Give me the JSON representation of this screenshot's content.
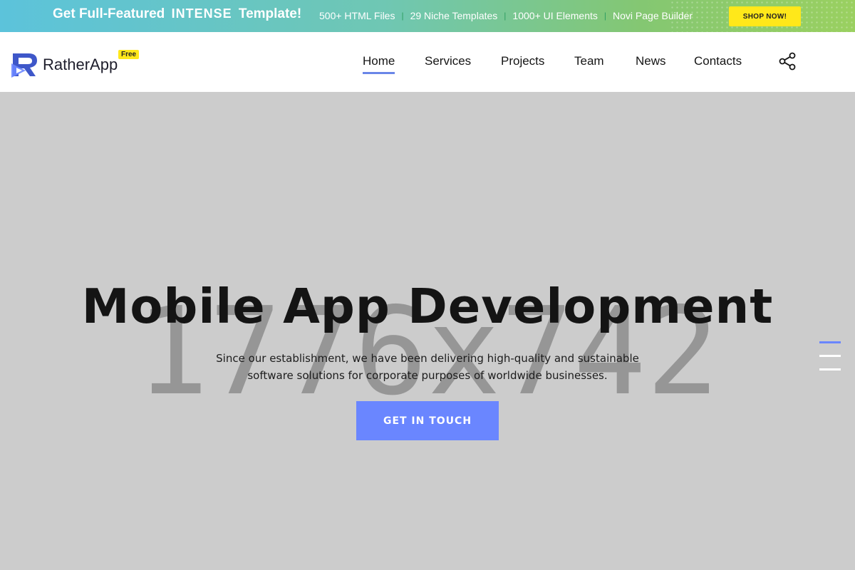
{
  "promo": {
    "headline_prefix": "Get Full-Featured",
    "headline_brand": "INTENSE",
    "headline_suffix": "Template!",
    "features": [
      "500+ HTML Files",
      "29 Niche Templates",
      "1000+ UI Elements",
      "Novi Page Builder"
    ],
    "separator": "|",
    "cta_label": "SHOP NOW!"
  },
  "header": {
    "logo_text": "RatherApp",
    "logo_badge": "Free",
    "nav": [
      "Home",
      "Services",
      "Projects",
      "Team",
      "News",
      "Contacts"
    ],
    "active_nav": "Home"
  },
  "hero": {
    "placeholder_size": "1776x742",
    "title": "Mobile App Development",
    "description_line1": "Since our establishment, we have been delivering high-quality and sustainable",
    "description_line2": "software solutions for corporate purposes of worldwide businesses.",
    "cta_label": "GET IN TOUCH"
  },
  "colors": {
    "accent": "#6a86ff",
    "badge_yellow": "#ffe81a",
    "hero_bg": "#cccccc"
  },
  "icons": {
    "share": "share-icon",
    "logo": "logo-icon"
  }
}
